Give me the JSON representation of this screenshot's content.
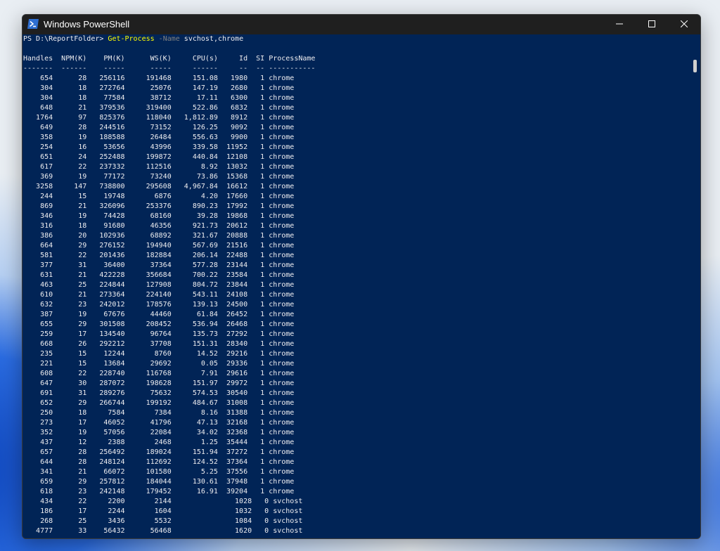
{
  "window": {
    "title": "Windows PowerShell",
    "icon": "powershell-icon"
  },
  "controls": {
    "minimize_icon": "minimize-icon",
    "maximize_icon": "maximize-icon",
    "close_icon": "close-icon"
  },
  "prompt": {
    "path": "PS D:\\ReportFolder> ",
    "command": "Get-Process",
    "param": " -Name",
    "args": " svchost,chrome"
  },
  "table": {
    "header": "Handles  NPM(K)    PM(K)      WS(K)     CPU(s)     Id  SI ProcessName",
    "separator": "-------  ------    -----      -----     ------     --  -- -----------",
    "rows": [
      "    654      28   256116     191468     151.08   1980   1 chrome",
      "    304      18   272764      25076     147.19   2680   1 chrome",
      "    304      18    77584      38712      17.11   6300   1 chrome",
      "    648      21   379536     319400     522.86   6832   1 chrome",
      "   1764      97   825376     118040   1,812.89   8912   1 chrome",
      "    649      28   244516      73152     126.25   9092   1 chrome",
      "    358      19   188588      26484     556.63   9900   1 chrome",
      "    254      16    53656      43996     339.58  11952   1 chrome",
      "    651      24   252488     199872     440.84  12108   1 chrome",
      "    617      22   237332     112516       8.92  13032   1 chrome",
      "    369      19    77172      73240      73.86  15368   1 chrome",
      "   3258     147   738800     295608   4,967.84  16612   1 chrome",
      "    244      15    19748       6876       4.20  17660   1 chrome",
      "    869      21   326096     253376     890.23  17992   1 chrome",
      "    346      19    74428      68160      39.28  19868   1 chrome",
      "    316      18    91680      46356     921.73  20612   1 chrome",
      "    386      20   102936      68892     321.67  20888   1 chrome",
      "    664      29   276152     194940     567.69  21516   1 chrome",
      "    581      22   201436     182884     206.14  22488   1 chrome",
      "    377      31    36400      37364     577.28  23144   1 chrome",
      "    631      21   422228     356684     700.22  23584   1 chrome",
      "    463      25   224844     127908     804.72  23844   1 chrome",
      "    610      21   273364     224140     543.11  24108   1 chrome",
      "    632      23   242012     178576     139.13  24500   1 chrome",
      "    387      19    67676      44460      61.84  26452   1 chrome",
      "    655      29   301508     208452     536.94  26468   1 chrome",
      "    259      17   134540      96764     135.73  27292   1 chrome",
      "    668      26   292212      37708     151.31  28340   1 chrome",
      "    235      15    12244       8760      14.52  29216   1 chrome",
      "    221      15    13684      29692       0.05  29336   1 chrome",
      "    608      22   228740     116768       7.91  29616   1 chrome",
      "    647      30   287072     198628     151.97  29972   1 chrome",
      "    691      31   289276      75632     574.53  30540   1 chrome",
      "    652      29   266744     199192     484.67  31008   1 chrome",
      "    250      18     7584       7384       8.16  31388   1 chrome",
      "    273      17    46052      41796      47.13  32168   1 chrome",
      "    352      19    57056      22084      34.02  32368   1 chrome",
      "    437      12     2388       2468       1.25  35444   1 chrome",
      "    657      28   256492     189024     151.94  37272   1 chrome",
      "    644      28   248124     112692     124.52  37364   1 chrome",
      "    341      21    66072     101580       5.25  37556   1 chrome",
      "    659      29   257812     184044     130.61  37948   1 chrome",
      "    618      23   242148     179452      16.91  39204   1 chrome",
      "    434      22     2200       2144               1028   0 svchost",
      "    186      17     2244       1604               1032   0 svchost",
      "    268      25     3436       5532               1084   0 svchost",
      "   4777      33    56432      56468               1620   0 svchost"
    ]
  },
  "colors": {
    "console_bg": "#012456",
    "titlebar_bg": "#1f1f1f",
    "command": "#ffff00",
    "parameter": "#808080",
    "text": "#eeedf0"
  }
}
